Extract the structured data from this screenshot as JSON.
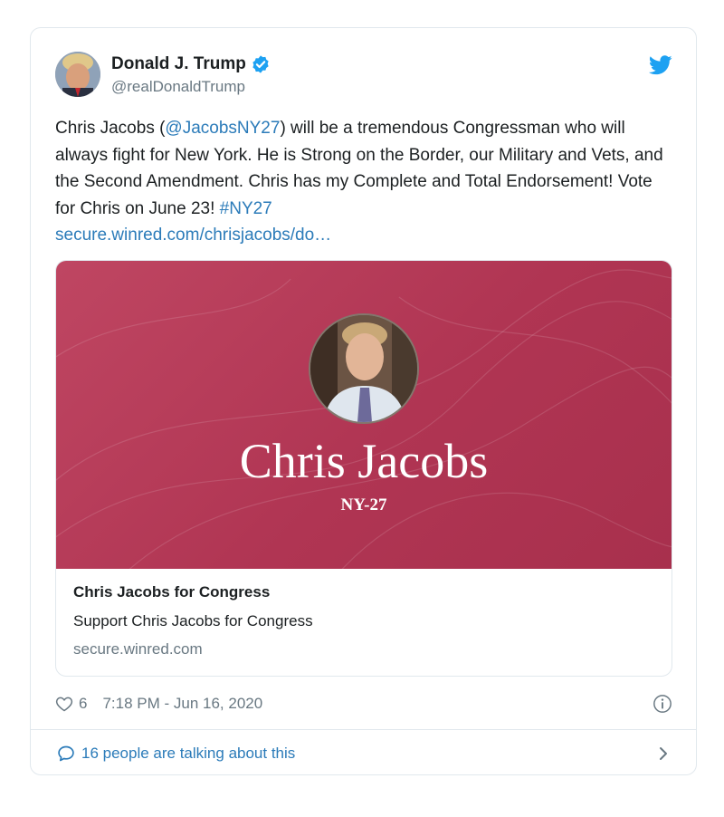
{
  "tweet": {
    "author_name": "Donald J. Trump",
    "author_handle": "@realDonaldTrump",
    "verified": true,
    "text_part1": "Chris Jacobs (",
    "mention": "@JacobsNY27",
    "text_part2": ") will be a tremendous Congressman who will always fight for New York. He is Strong on the Border, our Military and Vets, and the Second Amendment. Chris has my Complete and Total Endorsement! Vote for Chris on June 23! ",
    "hashtag": "#NY27",
    "url": "secure.winred.com/chrisjacobs/do…",
    "like_count": "6",
    "timestamp": "7:18 PM - Jun 16, 2020",
    "talking": "16 people are talking about this"
  },
  "preview": {
    "image_name": "Chris Jacobs",
    "image_district": "NY-27",
    "title": "Chris Jacobs for Congress",
    "description": "Support Chris Jacobs for Congress",
    "domain": "secure.winred.com"
  },
  "colors": {
    "link": "#2b7bb9",
    "twitter_blue": "#1da1f2",
    "muted": "#697882",
    "card_red": "#b03553"
  },
  "icons": {
    "verified": "verified-badge-icon",
    "bird": "twitter-bird-icon",
    "like": "heart-icon",
    "info": "info-icon",
    "reply": "speech-bubble-icon",
    "chevron": "chevron-right-icon"
  }
}
